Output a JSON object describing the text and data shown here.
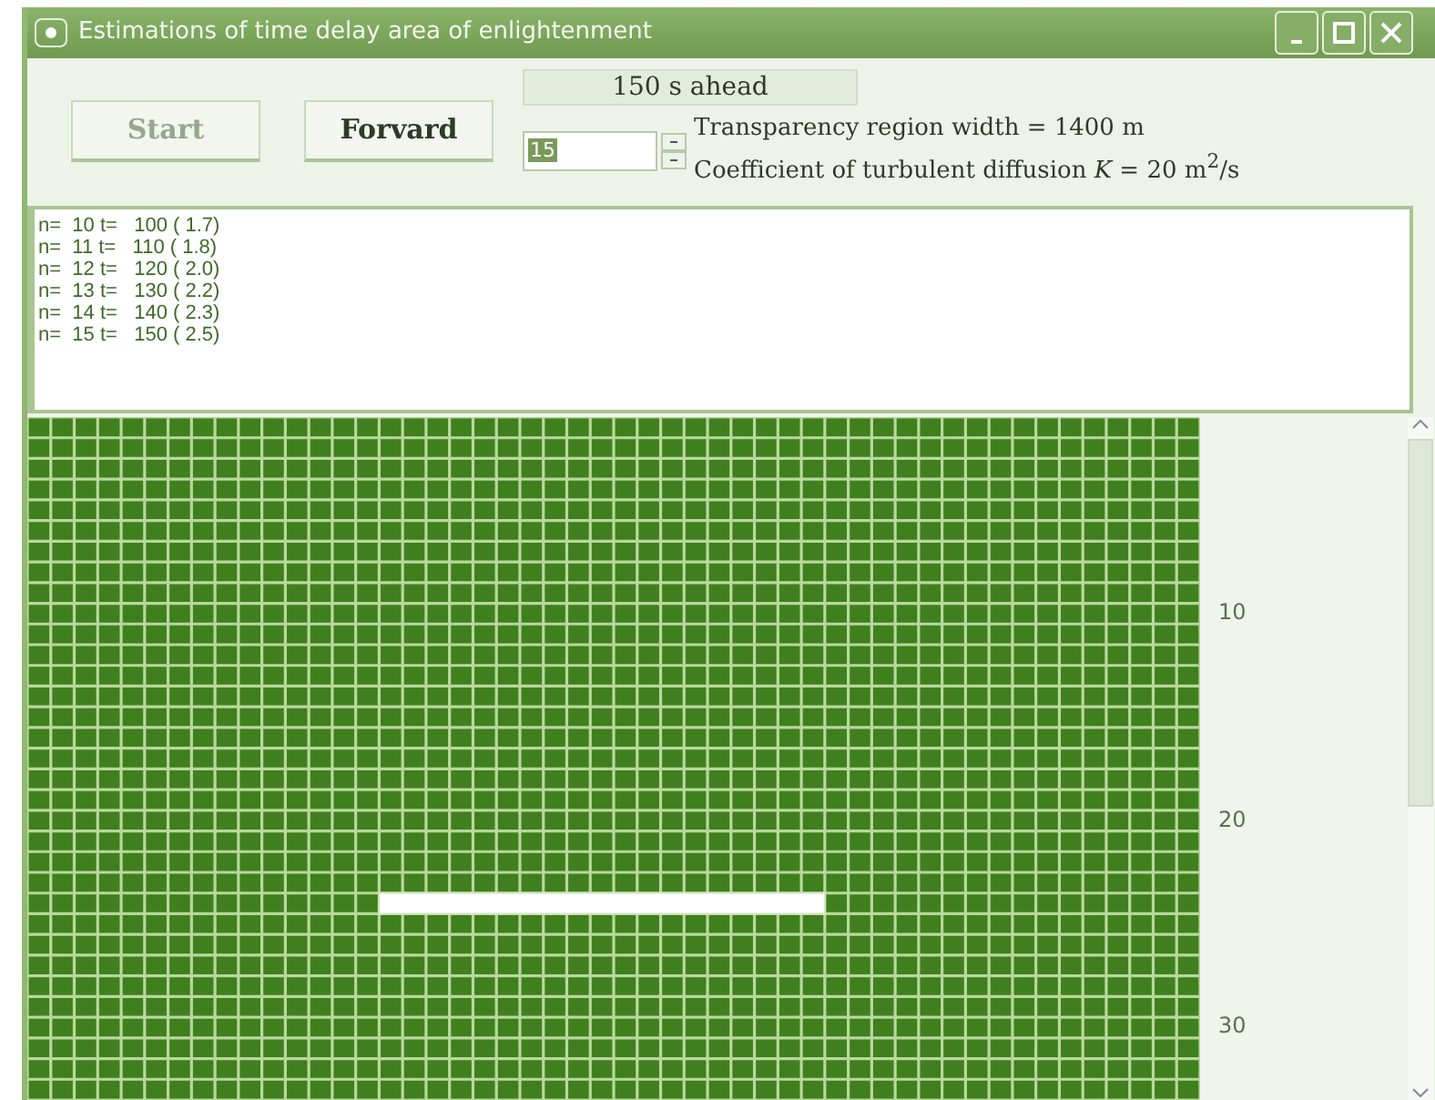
{
  "window": {
    "title": "Estimations of time delay area of enlightenment"
  },
  "toolbar": {
    "status": "150 s ahead",
    "buttons": [
      {
        "label": "Start",
        "disabled": true
      },
      {
        "label": "Forvard",
        "disabled": false
      }
    ],
    "spinner": {
      "value": "15"
    },
    "info": [
      "Transparency region width = 1400 m",
      "Coefficient of turbulent diffusion *K* = 20 m$^{2}$/s"
    ]
  },
  "log": [
    "n=  10 t=   100 ( 1.7)",
    "n=  11 t=   110 ( 1.8)",
    "n=  12 t=   120 ( 2.0)",
    "n=  13 t=   130 ( 2.2)",
    "n=  14 t=   140 ( 2.3)",
    "n=  15 t=   150 ( 2.5)"
  ],
  "grid": {
    "row_labels": [
      "10",
      "20",
      "30"
    ]
  }
}
